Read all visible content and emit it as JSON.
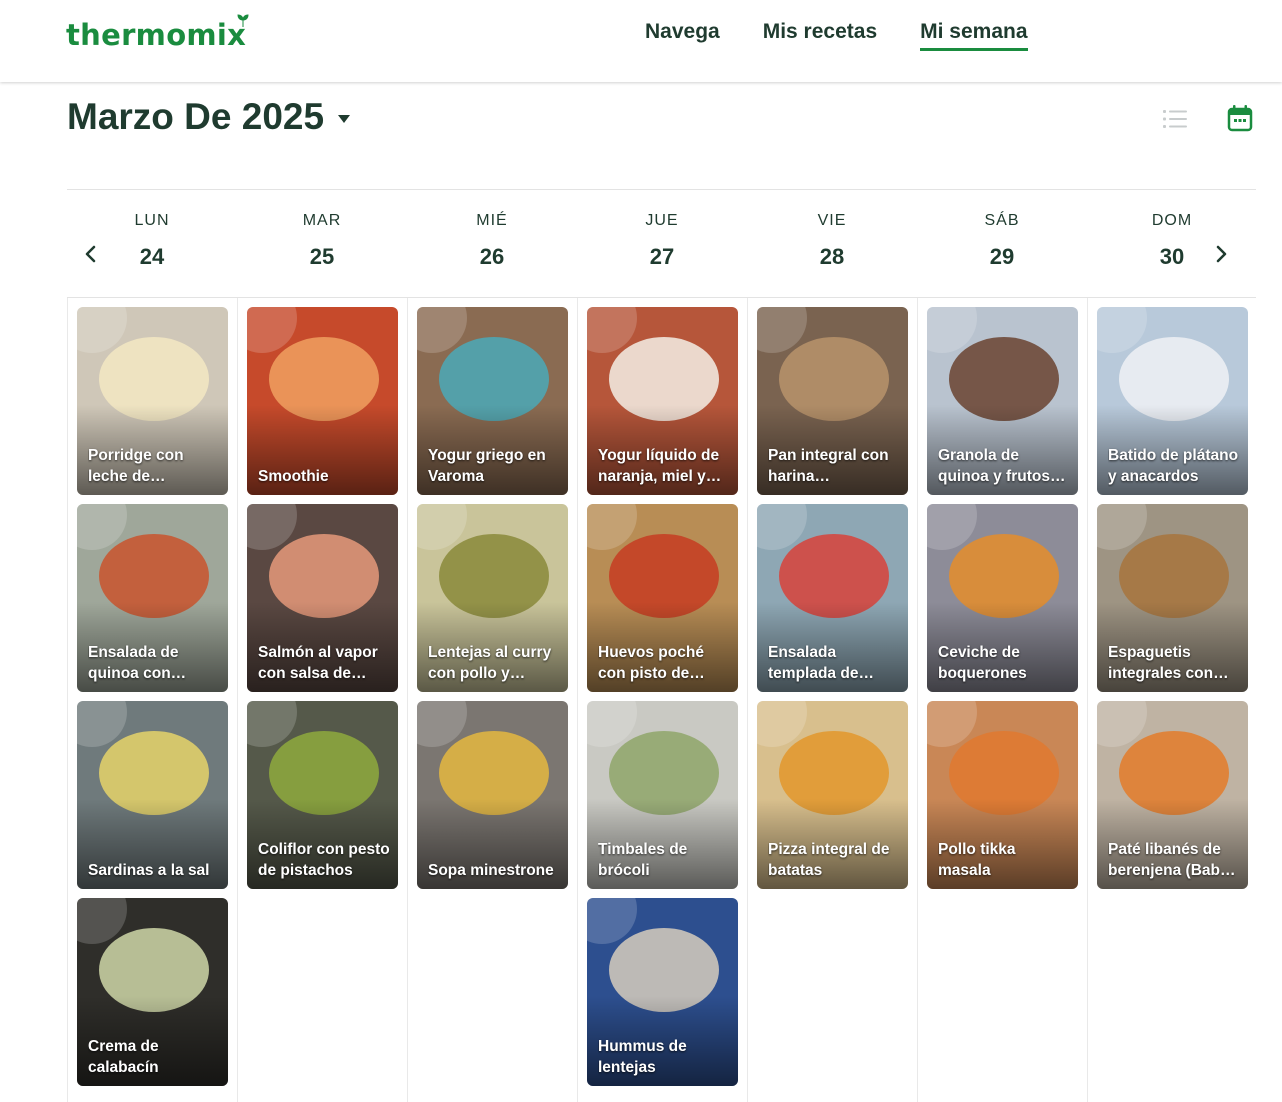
{
  "header": {
    "logo_text": "thermomix",
    "nav": [
      {
        "label": "Navega",
        "active": false
      },
      {
        "label": "Mis recetas",
        "active": false
      },
      {
        "label": "Mi semana",
        "active": true
      }
    ]
  },
  "calendar": {
    "month_label": "Marzo De 2025",
    "views": [
      "list-view-icon",
      "calendar-view-icon"
    ],
    "days": [
      {
        "dow": "LUN",
        "num": "24"
      },
      {
        "dow": "MAR",
        "num": "25"
      },
      {
        "dow": "MIÉ",
        "num": "26"
      },
      {
        "dow": "JUE",
        "num": "27"
      },
      {
        "dow": "VIE",
        "num": "28"
      },
      {
        "dow": "SÁB",
        "num": "29"
      },
      {
        "dow": "DOM",
        "num": "30"
      }
    ]
  },
  "columns": [
    [
      {
        "title": "Porridge con leche de…",
        "bg": "#cfc7b8",
        "deco": "#f3e7c2"
      },
      {
        "title": "Ensalada de quinoa con…",
        "bg": "#9fa79a",
        "deco": "#c9532d"
      },
      {
        "title": "Sardinas a la sal",
        "bg": "#6f7a7c",
        "deco": "#e6d46a"
      },
      {
        "title": "Crema de calabacín",
        "bg": "#2f2e2a",
        "deco": "#cfd7a8"
      }
    ],
    [
      {
        "title": "Smoothie",
        "bg": "#c64a2b",
        "deco": "#f0a060"
      },
      {
        "title": "Salmón al vapor con salsa de…",
        "bg": "#5a4842",
        "deco": "#e69a7a"
      },
      {
        "title": "Coliflor con pesto de pistachos",
        "bg": "#55594a",
        "deco": "#8faa3d"
      }
    ],
    [
      {
        "title": "Yogur griego en Varoma",
        "bg": "#8a6b52",
        "deco": "#4aa9b8"
      },
      {
        "title": "Lentejas al curry con pollo y…",
        "bg": "#c9c49a",
        "deco": "#8a8a3a"
      },
      {
        "title": "Sopa minestrone",
        "bg": "#7b7671",
        "deco": "#e5b840"
      }
    ],
    [
      {
        "title": "Yogur líquido de naranja, miel y…",
        "bg": "#b6563a",
        "deco": "#f4efe6"
      },
      {
        "title": "Huevos poché con pisto de…",
        "bg": "#b88d55",
        "deco": "#c63c22"
      },
      {
        "title": "Timbales de brócoli",
        "bg": "#c9c9c3",
        "deco": "#8fa66a"
      },
      {
        "title": "Hummus de lentejas",
        "bg": "#2d4f8f",
        "deco": "#d7cdbd"
      }
    ],
    [
      {
        "title": "Pan integral con harina…",
        "bg": "#7a6350",
        "deco": "#b8936b"
      },
      {
        "title": "Ensalada templada de…",
        "bg": "#8ea7b4",
        "deco": "#d8423a"
      },
      {
        "title": "Pizza integral de batatas",
        "bg": "#d8bf8d",
        "deco": "#e3962c"
      }
    ],
    [
      {
        "title": "Granola de quinoa y frutos…",
        "bg": "#b9c3cf",
        "deco": "#6a4330"
      },
      {
        "title": "Ceviche de boquerones",
        "bg": "#8d8c98",
        "deco": "#e58d2a"
      },
      {
        "title": "Pollo tikka masala",
        "bg": "#c98756",
        "deco": "#e0792f"
      }
    ],
    [
      {
        "title": "Batido de plátano y anacardos",
        "bg": "#b8c9da",
        "deco": "#eef1f4"
      },
      {
        "title": "Espaguetis integrales con…",
        "bg": "#9e9483",
        "deco": "#a7743d"
      },
      {
        "title": "Paté libanés de berenjena (Bab…",
        "bg": "#bfb3a3",
        "deco": "#e37b2a"
      }
    ]
  ]
}
